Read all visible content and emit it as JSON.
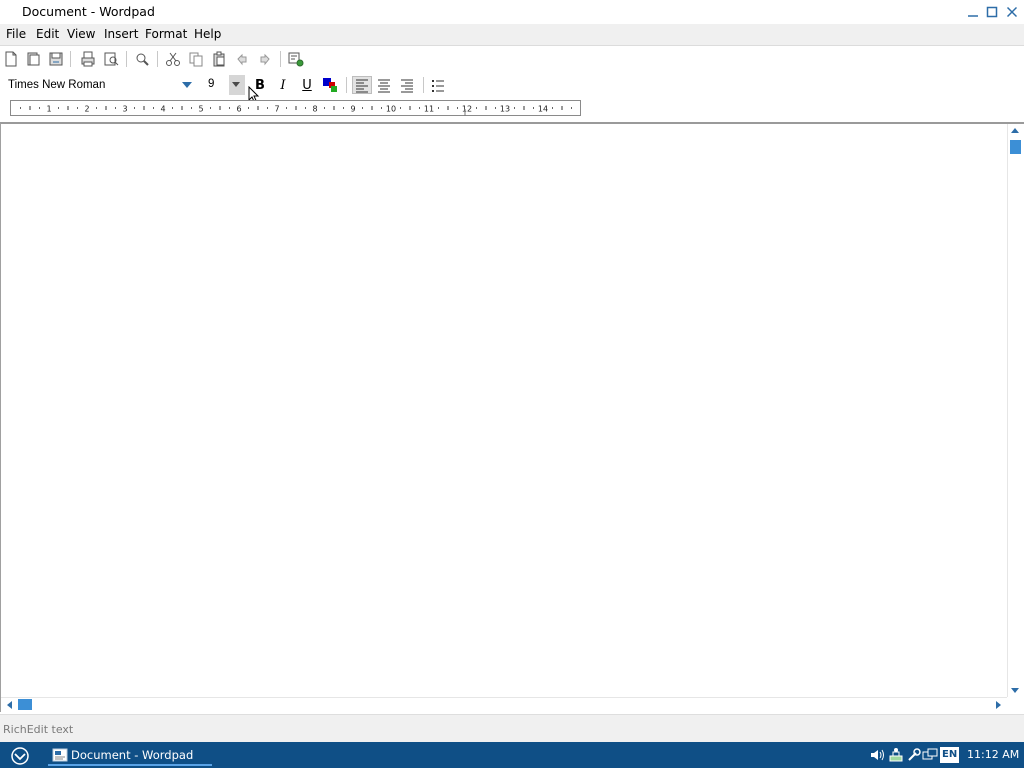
{
  "window": {
    "title": "Document - Wordpad"
  },
  "menubar": {
    "items": [
      {
        "id": "file",
        "label": "File"
      },
      {
        "id": "edit",
        "label": "Edit"
      },
      {
        "id": "view",
        "label": "View"
      },
      {
        "id": "insert",
        "label": "Insert"
      },
      {
        "id": "format",
        "label": "Format"
      },
      {
        "id": "help",
        "label": "Help"
      }
    ]
  },
  "toolbar": {
    "icons": [
      "new-document-icon",
      "open-icon",
      "save-icon",
      "print-icon",
      "print-preview-icon",
      "find-icon",
      "cut-icon",
      "copy-icon",
      "paste-icon",
      "undo-icon",
      "redo-icon",
      "insert-datetime-icon"
    ]
  },
  "formatbar": {
    "font": "Times New Roman",
    "size": "9",
    "bold": "B",
    "italic": "I",
    "underline": "U"
  },
  "ruler": {
    "numbers": [
      "1",
      "2",
      "3",
      "4",
      "5",
      "6",
      "7",
      "8",
      "9",
      "10",
      "11",
      "12",
      "13",
      "14"
    ]
  },
  "statusbar": {
    "text": "RichEdit text"
  },
  "taskbar": {
    "task_label": "Document - Wordpad",
    "language": "EN",
    "clock": "11:12 AM"
  },
  "colors": {
    "accent": "#2d6da8",
    "scroll_thumb": "#3c8fd6",
    "taskbar": "#0f4f86"
  }
}
